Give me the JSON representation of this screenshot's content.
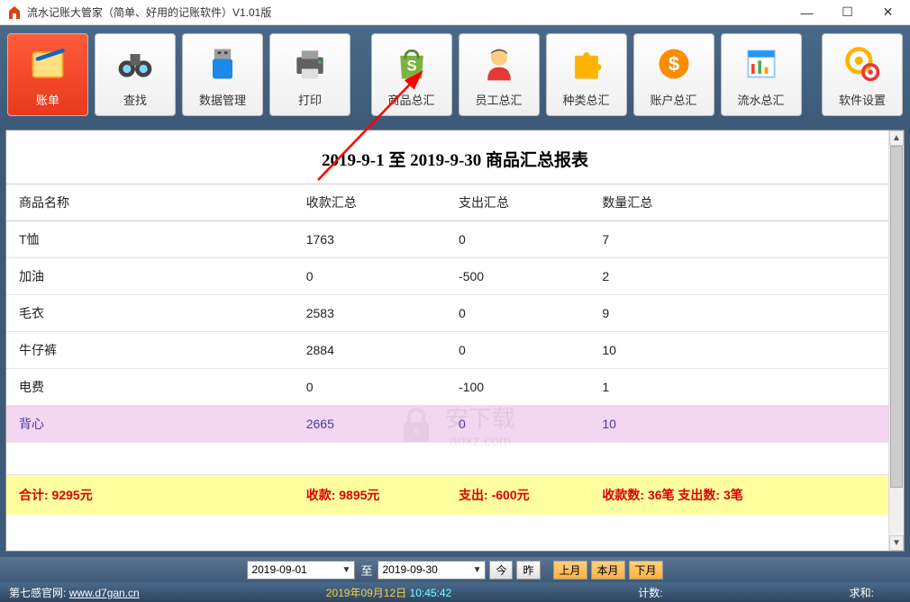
{
  "window": {
    "title": "流水记账大管家（简单、好用的记账软件）V1.01版"
  },
  "toolbar": {
    "items": [
      {
        "label": "账单",
        "icon": "bill-icon"
      },
      {
        "label": "查找",
        "icon": "search-icon"
      },
      {
        "label": "数据管理",
        "icon": "usb-icon"
      },
      {
        "label": "打印",
        "icon": "printer-icon"
      },
      {
        "label": "商品总汇",
        "icon": "bag-icon"
      },
      {
        "label": "员工总汇",
        "icon": "person-icon"
      },
      {
        "label": "种类总汇",
        "icon": "puzzle-icon"
      },
      {
        "label": "账户总汇",
        "icon": "money-icon"
      },
      {
        "label": "流水总汇",
        "icon": "report-icon"
      },
      {
        "label": "软件设置",
        "icon": "gear-icon"
      }
    ]
  },
  "report": {
    "title": "2019-9-1 至 2019-9-30 商品汇总报表",
    "headers": [
      "商品名称",
      "收款汇总",
      "支出汇总",
      "数量汇总"
    ],
    "rows": [
      {
        "name": "T恤",
        "income": "1763",
        "expense": "0",
        "qty": "7"
      },
      {
        "name": "加油",
        "income": "0",
        "expense": "-500",
        "qty": "2"
      },
      {
        "name": "毛衣",
        "income": "2583",
        "expense": "0",
        "qty": "9"
      },
      {
        "name": "牛仔裤",
        "income": "2884",
        "expense": "0",
        "qty": "10"
      },
      {
        "name": "电费",
        "income": "0",
        "expense": "-100",
        "qty": "1"
      },
      {
        "name": "背心",
        "income": "2665",
        "expense": "0",
        "qty": "10"
      }
    ],
    "totals": {
      "sum_label": "合计:",
      "sum_value": "9295元",
      "income_label": "收款:",
      "income_value": "9895元",
      "expense_label": "支出:",
      "expense_value": "-600元",
      "count_label": "收款数: 36笔   支出数: 3笔"
    }
  },
  "datebar": {
    "from": "2019-09-01",
    "to_label": "至",
    "to": "2019-09-30",
    "today": "今",
    "yesterday": "昨",
    "last_month": "上月",
    "this_month": "本月",
    "next_month": "下月"
  },
  "statusbar": {
    "site_label": "第七感官网:",
    "site_url": "www.d7gan.cn",
    "date": "2019年09月12日",
    "time": "10:45:42",
    "count_label": "计数:",
    "sum_label": "求和:"
  },
  "watermark": {
    "text1": "安下载",
    "text2": "anxz.com"
  }
}
